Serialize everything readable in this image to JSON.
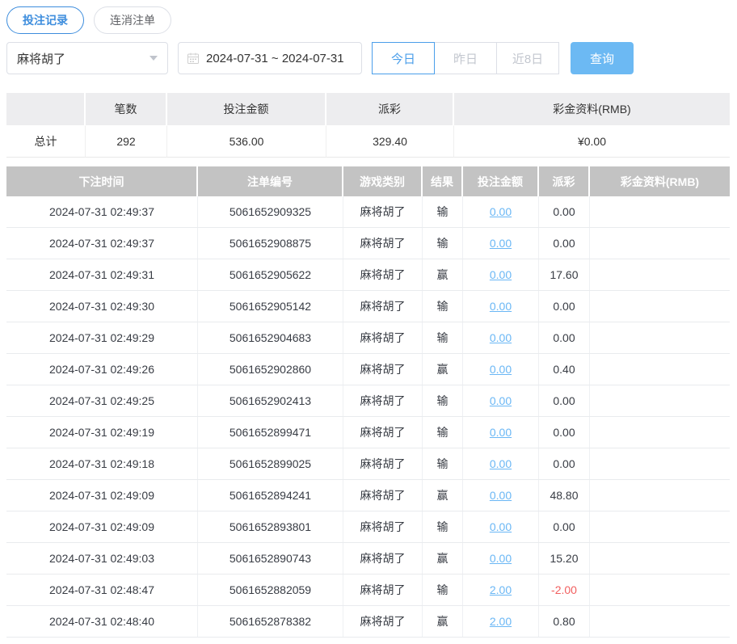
{
  "tabs": [
    {
      "label": "投注记录",
      "active": true
    },
    {
      "label": "连消注单",
      "active": false
    }
  ],
  "filters": {
    "game_select": {
      "value": "麻将胡了"
    },
    "date_range": {
      "value": "2024-07-31 ~ 2024-07-31"
    },
    "quick_buttons": [
      {
        "label": "今日",
        "active": true
      },
      {
        "label": "昨日",
        "active": false
      },
      {
        "label": "近8日",
        "active": false
      }
    ],
    "search_label": "查询"
  },
  "summary": {
    "headers": [
      "",
      "笔数",
      "投注金额",
      "派彩",
      "彩金资料(RMB)"
    ],
    "row": {
      "label": "总计",
      "count": "292",
      "bet_amount": "536.00",
      "payout": "329.40",
      "bonus": "¥0.00"
    }
  },
  "records": {
    "headers": [
      "下注时间",
      "注单编号",
      "游戏类别",
      "结果",
      "投注金额",
      "派彩",
      "彩金资料(RMB)"
    ],
    "rows": [
      {
        "time": "2024-07-31 02:49:37",
        "order_id": "5061652909325",
        "game": "麻将胡了",
        "result": "输",
        "bet": "0.00",
        "payout": "0.00",
        "bonus": ""
      },
      {
        "time": "2024-07-31 02:49:37",
        "order_id": "5061652908875",
        "game": "麻将胡了",
        "result": "输",
        "bet": "0.00",
        "payout": "0.00",
        "bonus": ""
      },
      {
        "time": "2024-07-31 02:49:31",
        "order_id": "5061652905622",
        "game": "麻将胡了",
        "result": "赢",
        "bet": "0.00",
        "payout": "17.60",
        "bonus": ""
      },
      {
        "time": "2024-07-31 02:49:30",
        "order_id": "5061652905142",
        "game": "麻将胡了",
        "result": "输",
        "bet": "0.00",
        "payout": "0.00",
        "bonus": ""
      },
      {
        "time": "2024-07-31 02:49:29",
        "order_id": "5061652904683",
        "game": "麻将胡了",
        "result": "输",
        "bet": "0.00",
        "payout": "0.00",
        "bonus": ""
      },
      {
        "time": "2024-07-31 02:49:26",
        "order_id": "5061652902860",
        "game": "麻将胡了",
        "result": "赢",
        "bet": "0.00",
        "payout": "0.40",
        "bonus": ""
      },
      {
        "time": "2024-07-31 02:49:25",
        "order_id": "5061652902413",
        "game": "麻将胡了",
        "result": "输",
        "bet": "0.00",
        "payout": "0.00",
        "bonus": ""
      },
      {
        "time": "2024-07-31 02:49:19",
        "order_id": "5061652899471",
        "game": "麻将胡了",
        "result": "输",
        "bet": "0.00",
        "payout": "0.00",
        "bonus": ""
      },
      {
        "time": "2024-07-31 02:49:18",
        "order_id": "5061652899025",
        "game": "麻将胡了",
        "result": "输",
        "bet": "0.00",
        "payout": "0.00",
        "bonus": ""
      },
      {
        "time": "2024-07-31 02:49:09",
        "order_id": "5061652894241",
        "game": "麻将胡了",
        "result": "赢",
        "bet": "0.00",
        "payout": "48.80",
        "bonus": ""
      },
      {
        "time": "2024-07-31 02:49:09",
        "order_id": "5061652893801",
        "game": "麻将胡了",
        "result": "输",
        "bet": "0.00",
        "payout": "0.00",
        "bonus": ""
      },
      {
        "time": "2024-07-31 02:49:03",
        "order_id": "5061652890743",
        "game": "麻将胡了",
        "result": "赢",
        "bet": "0.00",
        "payout": "15.20",
        "bonus": ""
      },
      {
        "time": "2024-07-31 02:48:47",
        "order_id": "5061652882059",
        "game": "麻将胡了",
        "result": "输",
        "bet": "2.00",
        "payout": "-2.00",
        "bonus": ""
      },
      {
        "time": "2024-07-31 02:48:40",
        "order_id": "5061652878382",
        "game": "麻将胡了",
        "result": "赢",
        "bet": "2.00",
        "payout": "0.80",
        "bonus": ""
      }
    ]
  },
  "colors": {
    "accent_blue": "#3d8ddd",
    "link_blue": "#6ab7f5",
    "search_button_bg": "#6cb9f3",
    "negative_red": "#f15f5f",
    "table_header_bg": "#c3c3c3",
    "summary_header_bg": "#ededef"
  }
}
